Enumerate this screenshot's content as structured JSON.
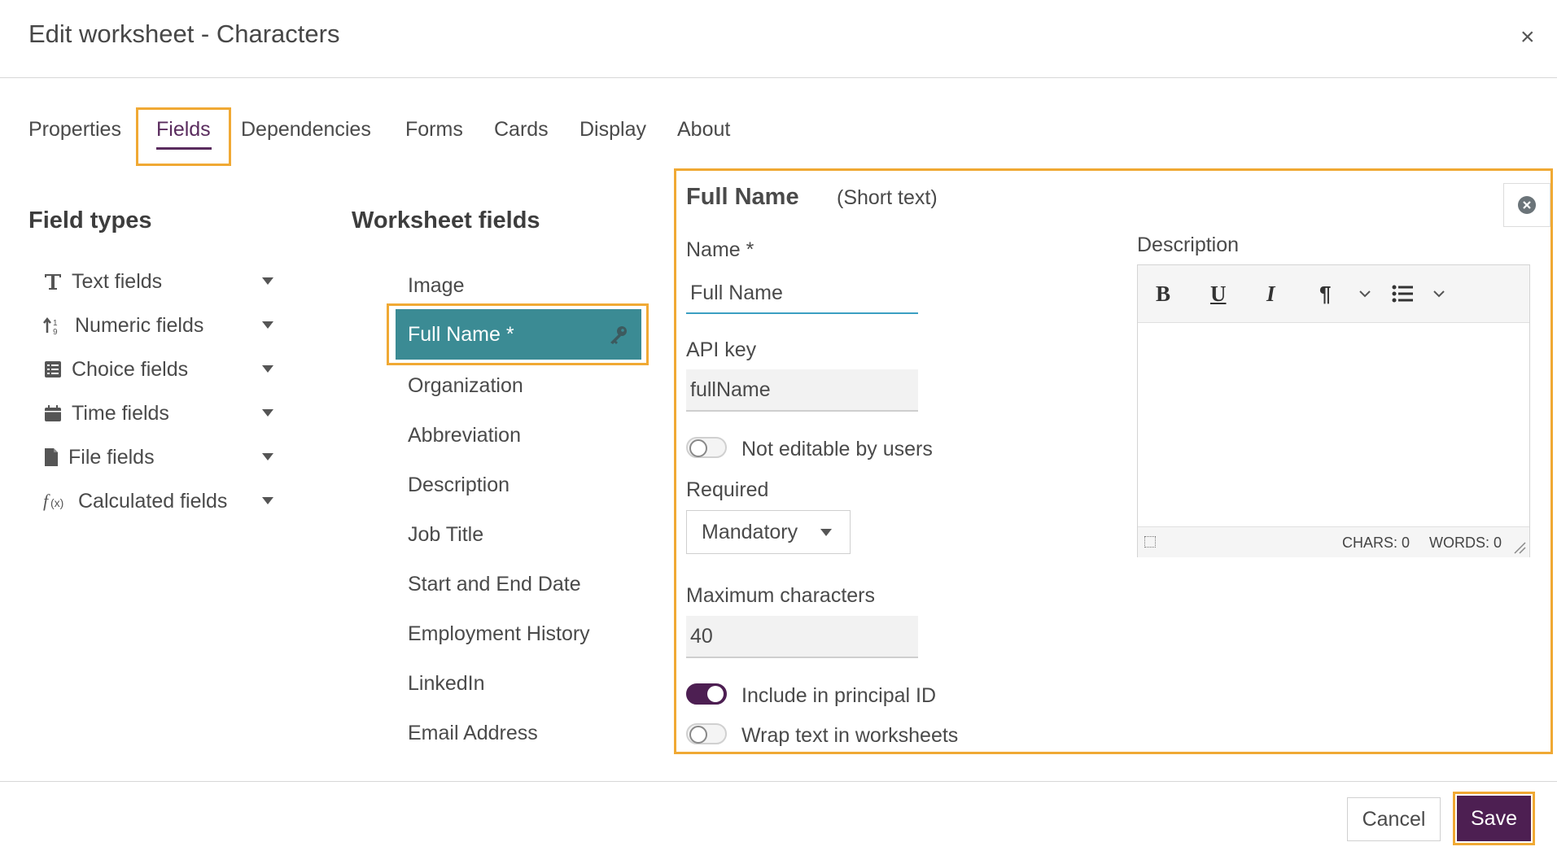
{
  "dialog": {
    "title": "Edit worksheet - Characters",
    "close_glyph": "×"
  },
  "tabs": [
    {
      "label": "Properties"
    },
    {
      "label": "Fields",
      "active": true
    },
    {
      "label": "Dependencies"
    },
    {
      "label": "Forms"
    },
    {
      "label": "Cards"
    },
    {
      "label": "Display"
    },
    {
      "label": "About"
    }
  ],
  "field_types": {
    "heading": "Field types",
    "items": [
      {
        "label": "Text fields",
        "icon": "text-icon"
      },
      {
        "label": "Numeric fields",
        "icon": "numeric-icon"
      },
      {
        "label": "Choice fields",
        "icon": "list-icon"
      },
      {
        "label": "Time fields",
        "icon": "calendar-icon"
      },
      {
        "label": "File fields",
        "icon": "file-icon"
      },
      {
        "label": "Calculated fields",
        "icon": "function-icon"
      }
    ]
  },
  "worksheet_fields": {
    "heading": "Worksheet fields",
    "items": [
      "Image",
      "Full Name *",
      "Organization",
      "Abbreviation",
      "Description",
      "Job Title",
      "Start and End Date",
      "Employment History",
      "LinkedIn",
      "Email Address"
    ],
    "selected": "Full Name *"
  },
  "editor": {
    "field_name": "Full Name",
    "field_type": "(Short text)",
    "name_label": "Name *",
    "name_value": "Full Name",
    "api_key_label": "API key",
    "api_key_value": "fullName",
    "not_editable_label": "Not editable by users",
    "not_editable_on": false,
    "required_label": "Required",
    "required_value": "Mandatory",
    "max_chars_label": "Maximum characters",
    "max_chars_value": "40",
    "principal_id_label": "Include in principal ID",
    "principal_id_on": true,
    "wrap_text_label": "Wrap text in worksheets",
    "wrap_text_on": false,
    "description_label": "Description",
    "toolbar": {
      "bold": "B",
      "underline": "U",
      "italic": "I",
      "paragraph": "¶"
    },
    "chars_count": "CHARS: 0",
    "words_count": "WORDS: 0"
  },
  "footer": {
    "cancel_label": "Cancel",
    "save_label": "Save"
  },
  "colors": {
    "accent": "#5a2c5e",
    "selected_field": "#3b8b94",
    "highlight": "#f0a934"
  }
}
